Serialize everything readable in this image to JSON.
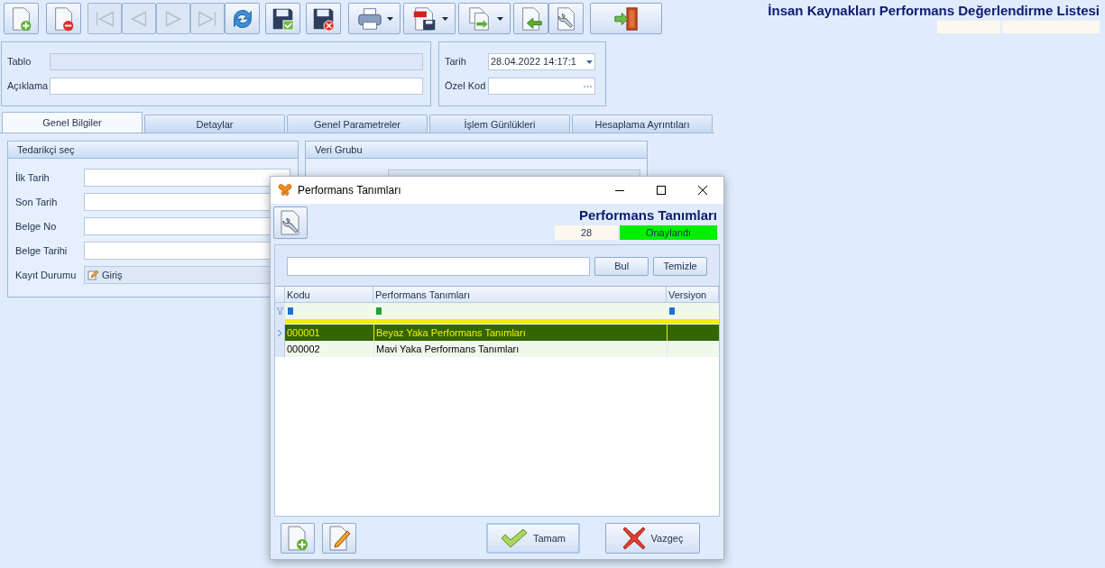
{
  "toolbar": [
    {
      "kind": "new",
      "disabled": false,
      "dropdown": false
    },
    {
      "kind": "delete",
      "disabled": false,
      "dropdown": false
    },
    {
      "kind": "first",
      "disabled": true,
      "dropdown": false
    },
    {
      "kind": "prev",
      "disabled": true,
      "dropdown": false
    },
    {
      "kind": "next",
      "disabled": true,
      "dropdown": false
    },
    {
      "kind": "last",
      "disabled": true,
      "dropdown": false
    },
    {
      "kind": "refresh",
      "disabled": false,
      "dropdown": false
    },
    {
      "kind": "save",
      "disabled": false,
      "dropdown": false
    },
    {
      "kind": "cancel-save",
      "disabled": false,
      "dropdown": false
    },
    {
      "kind": "print",
      "disabled": false,
      "dropdown": true
    },
    {
      "kind": "pdf",
      "disabled": false,
      "dropdown": true
    },
    {
      "kind": "copy",
      "disabled": false,
      "dropdown": true
    },
    {
      "kind": "import",
      "disabled": false,
      "dropdown": false
    },
    {
      "kind": "settings",
      "disabled": false,
      "dropdown": false
    },
    {
      "kind": "exit",
      "disabled": false,
      "dropdown": false
    }
  ],
  "page_title": "İnsan Kaynakları Performans Değerlendirme Listesi",
  "header": {
    "tablo_label": "Tablo",
    "aciklama_label": "Açıklama",
    "tarih_label": "Tarih",
    "tarih_value": "28.04.2022 14:17:1",
    "ozel_kod_label": "Özel Kod"
  },
  "tabs": [
    {
      "label": "Genel Bilgiler",
      "selected": true
    },
    {
      "label": "Detaylar",
      "selected": false
    },
    {
      "label": "Genel Parametreler",
      "selected": false
    },
    {
      "label": "İşlem Günlükleri",
      "selected": false
    },
    {
      "label": "Hesaplama Ayrıntıları",
      "selected": false
    }
  ],
  "tedarikci": {
    "title": "Tedarikçi seç",
    "fields": [
      "İlk Tarih",
      "Son Tarih",
      "Belge No",
      "Belge Tarihi"
    ],
    "kayit_label": "Kayıt Durumu",
    "kayit_value": "Giriş"
  },
  "veri_grubu": {
    "title": "Veri Grubu"
  },
  "dialog": {
    "window_title": "Performans Tanımları",
    "heading": "Performans Tanımları",
    "count": "28",
    "status": "Onaylandı",
    "find_button": "Bul",
    "clear_button": "Temizle",
    "columns": [
      "Kodu",
      "Performans Tanımları",
      "Versiyon"
    ],
    "rows": [
      {
        "kodu": "000001",
        "tanim": "Beyaz Yaka Performans Tanımları",
        "selected": true
      },
      {
        "kodu": "000002",
        "tanim": "Mavi Yaka Performans Tanımları",
        "selected": false
      }
    ],
    "ok_button": "Tamam",
    "cancel_button": "Vazgeç"
  }
}
